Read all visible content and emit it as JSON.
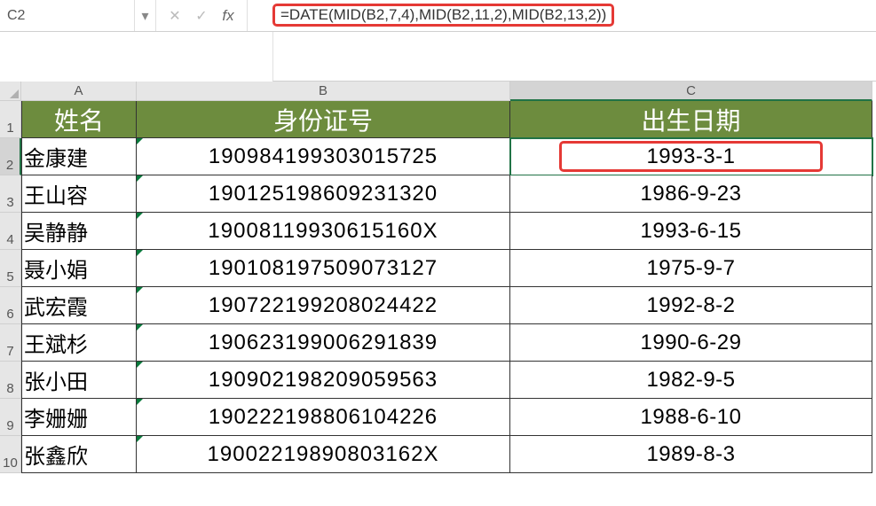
{
  "formula_bar": {
    "name_box": "C2",
    "dropdown_glyph": "▾",
    "cancel_glyph": "✕",
    "enter_glyph": "✓",
    "fx_label": "fx",
    "formula": "=DATE(MID(B2,7,4),MID(B2,11,2),MID(B2,13,2))"
  },
  "columns": [
    "A",
    "B",
    "C"
  ],
  "headers": {
    "name": "姓名",
    "id": "身份证号",
    "date": "出生日期"
  },
  "rows": [
    {
      "n": 2,
      "name": "金康建",
      "id": "190984199303015725",
      "date": "1993-3-1"
    },
    {
      "n": 3,
      "name": "王山容",
      "id": "190125198609231320",
      "date": "1986-9-23"
    },
    {
      "n": 4,
      "name": "吴静静",
      "id": "19008119930615160X",
      "date": "1993-6-15"
    },
    {
      "n": 5,
      "name": "聂小娟",
      "id": "190108197509073127",
      "date": "1975-9-7"
    },
    {
      "n": 6,
      "name": "武宏霞",
      "id": "190722199208024422",
      "date": "1992-8-2"
    },
    {
      "n": 7,
      "name": "王斌杉",
      "id": "190623199006291839",
      "date": "1990-6-29"
    },
    {
      "n": 8,
      "name": "张小田",
      "id": "190902198209059563",
      "date": "1982-9-5"
    },
    {
      "n": 9,
      "name": "李姗姗",
      "id": "190222198806104226",
      "date": "1988-6-10"
    },
    {
      "n": 10,
      "name": "张鑫欣",
      "id": "19002219890803162X",
      "date": "1989-8-3"
    }
  ],
  "active_cell": "C2",
  "selected_col": "C",
  "selected_row": 2
}
